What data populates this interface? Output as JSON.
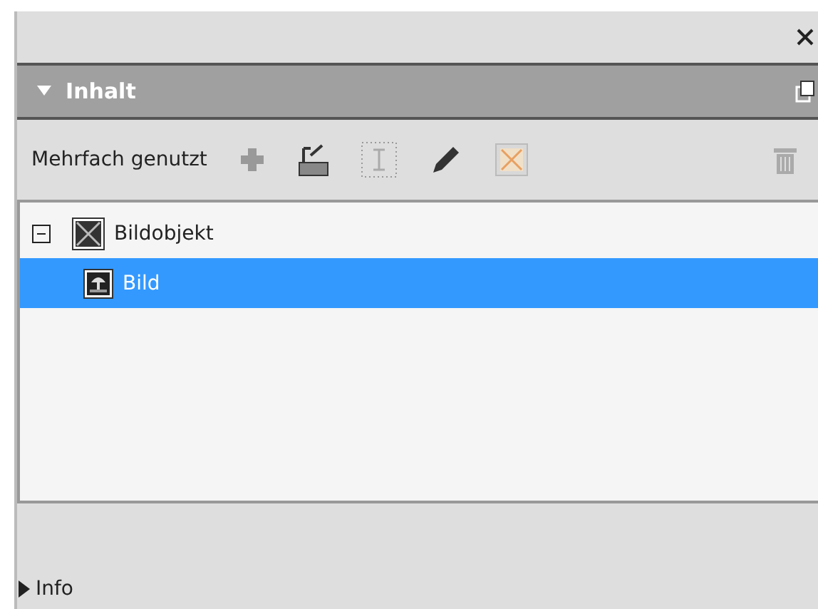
{
  "section": {
    "title": "Inhalt",
    "expanded": true
  },
  "toolbar": {
    "label": "Mehrfach genutzt"
  },
  "tree": [
    {
      "label": "Bildobjekt",
      "expanded": true,
      "selected": false,
      "kind": "object",
      "children": [
        {
          "label": "Bild",
          "selected": true,
          "kind": "image"
        }
      ]
    }
  ],
  "info": {
    "title": "Info",
    "expanded": false
  }
}
